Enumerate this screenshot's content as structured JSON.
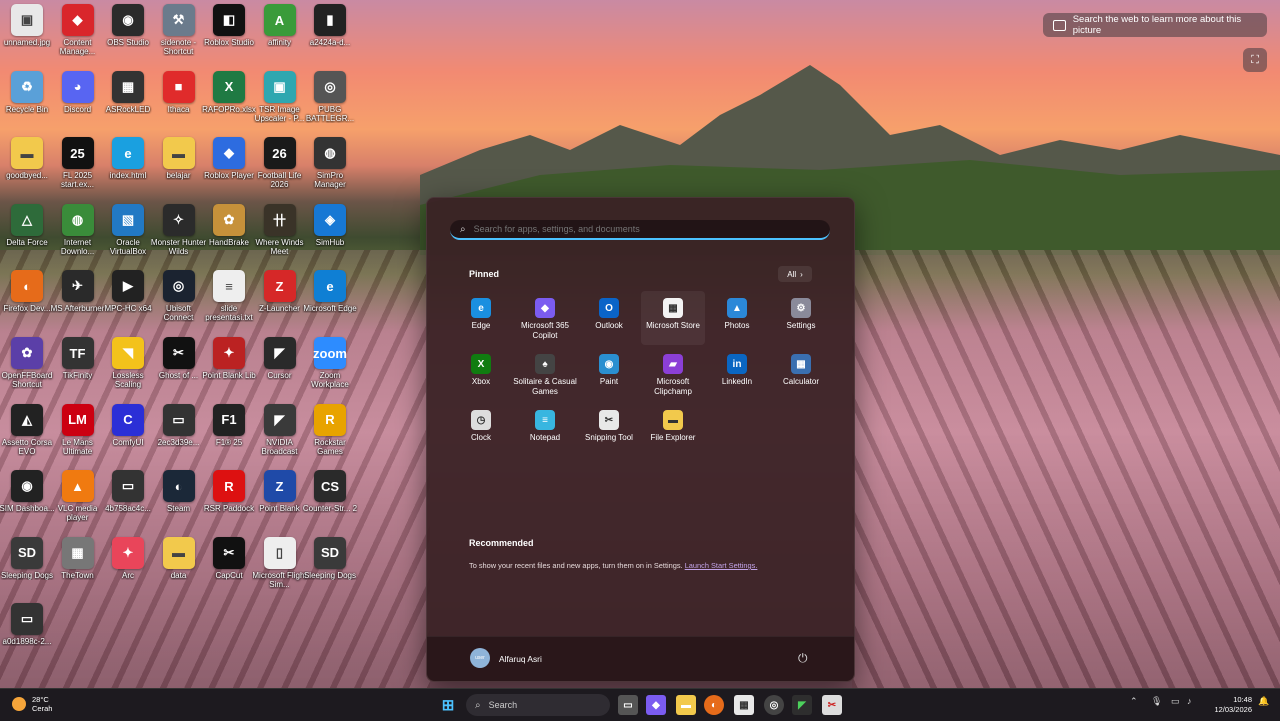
{
  "bing": {
    "text": "Search the web to learn more about this picture"
  },
  "desktop_icons": [
    {
      "label": "unnamed.jpg",
      "color": "#e8e8e8",
      "glyph": "▣"
    },
    {
      "label": "Content Manage...",
      "color": "#d9262b",
      "glyph": "◆"
    },
    {
      "label": "OBS Studio",
      "color": "#2b2b2b",
      "glyph": "◉"
    },
    {
      "label": "sidenote - Shortcut",
      "color": "#6b7b8c",
      "glyph": "⚒"
    },
    {
      "label": "Roblox Studio",
      "color": "#111",
      "glyph": "◧"
    },
    {
      "label": "affinity",
      "color": "#3a9b3a",
      "glyph": "A"
    },
    {
      "label": "a2424a-d...",
      "color": "#222",
      "glyph": "▮"
    },
    {
      "label": "Recycle Bin",
      "color": "#5aa0d8",
      "glyph": "♻"
    },
    {
      "label": "Discord",
      "color": "#5865f2",
      "glyph": "◕"
    },
    {
      "label": "ASRockLED",
      "color": "#333",
      "glyph": "▦"
    },
    {
      "label": "Ithaca",
      "color": "#e02b2b",
      "glyph": "■"
    },
    {
      "label": "RAFOPRo.xlsx",
      "color": "#1f7a43",
      "glyph": "X"
    },
    {
      "label": "TSR Image Upscaler - P...",
      "color": "#2ea7b0",
      "glyph": "▣"
    },
    {
      "label": "PUBG BATTLEGR...",
      "color": "#555",
      "glyph": "◎"
    },
    {
      "label": "goodbyed...",
      "color": "#f2c94c",
      "glyph": "▬"
    },
    {
      "label": "FL 2025 start.ex...",
      "color": "#111",
      "glyph": "25"
    },
    {
      "label": "index.html",
      "color": "#1aa0e0",
      "glyph": "e"
    },
    {
      "label": "belajar",
      "color": "#f2c94c",
      "glyph": "▬"
    },
    {
      "label": "Roblox Player",
      "color": "#2d6ce0",
      "glyph": "◆"
    },
    {
      "label": "Football Life 2026",
      "color": "#1a1a1a",
      "glyph": "26"
    },
    {
      "label": "SimPro Manager",
      "color": "#333",
      "glyph": "◍"
    },
    {
      "label": "Delta Force",
      "color": "#2e6b3a",
      "glyph": "△"
    },
    {
      "label": "Internet Downlo...",
      "color": "#3a8c3a",
      "glyph": "◍"
    },
    {
      "label": "Oracle VirtualBox",
      "color": "#2279c4",
      "glyph": "▧"
    },
    {
      "label": "Monster Hunter Wilds",
      "color": "#2b2b2b",
      "glyph": "✧"
    },
    {
      "label": "HandBrake",
      "color": "#c6913a",
      "glyph": "✿"
    },
    {
      "label": "Where Winds Meet",
      "color": "#3a3328",
      "glyph": "卄"
    },
    {
      "label": "SimHub",
      "color": "#1778d4",
      "glyph": "◈"
    },
    {
      "label": "Firefox Dev...",
      "color": "#e66b1a",
      "glyph": "◐"
    },
    {
      "label": "MS Afterburner",
      "color": "#2a2a2a",
      "glyph": "✈"
    },
    {
      "label": "MPC-HC x64",
      "color": "#222",
      "glyph": "▶"
    },
    {
      "label": "Ubisoft Connect",
      "color": "#1b2330",
      "glyph": "◎"
    },
    {
      "label": "slide presentasi.txt",
      "color": "#eee",
      "glyph": "≡"
    },
    {
      "label": "Z-Launcher",
      "color": "#d62828",
      "glyph": "Z"
    },
    {
      "label": "Microsoft Edge",
      "color": "#0f7fd4",
      "glyph": "e"
    },
    {
      "label": "OpenFFBoard Shortcut",
      "color": "#5b3fa8",
      "glyph": "✿"
    },
    {
      "label": "TikFinity",
      "color": "#333",
      "glyph": "TF"
    },
    {
      "label": "Lossless Scaling",
      "color": "#f3c21b",
      "glyph": "◥"
    },
    {
      "label": "Ghost of ...",
      "color": "#111",
      "glyph": "✂"
    },
    {
      "label": "Point Blank Lib",
      "color": "#b22",
      "glyph": "✦"
    },
    {
      "label": "Cursor",
      "color": "#2a2a2a",
      "glyph": "◤"
    },
    {
      "label": "Zoom Workplace",
      "color": "#2d8cff",
      "glyph": "zoom"
    },
    {
      "label": "Assetto Corsa EVO",
      "color": "#222",
      "glyph": "◭"
    },
    {
      "label": "Le Mans Ultimate",
      "color": "#c01",
      "glyph": "LM"
    },
    {
      "label": "ComfyUI",
      "color": "#2b2fd6",
      "glyph": "C"
    },
    {
      "label": "2ec3d39e...",
      "color": "#333",
      "glyph": "▭"
    },
    {
      "label": "F1® 25",
      "color": "#222",
      "glyph": "F1"
    },
    {
      "label": "NVIDIA Broadcast",
      "color": "#3a3a3a",
      "glyph": "◤"
    },
    {
      "label": "Rockstar Games",
      "color": "#e8a300",
      "glyph": "R"
    },
    {
      "label": "SIM Dashboa...",
      "color": "#222",
      "glyph": "◉"
    },
    {
      "label": "VLC media player",
      "color": "#f07a10",
      "glyph": "▲"
    },
    {
      "label": "4b758ac4c...",
      "color": "#333",
      "glyph": "▭"
    },
    {
      "label": "Steam",
      "color": "#1b2838",
      "glyph": "◐"
    },
    {
      "label": "RSR Paddock",
      "color": "#d11",
      "glyph": "R"
    },
    {
      "label": "Point Blank",
      "color": "#1f4aa8",
      "glyph": "Z"
    },
    {
      "label": "Counter-Str... 2",
      "color": "#2a2a2a",
      "glyph": "CS"
    },
    {
      "label": "Sleeping Dogs",
      "color": "#3a3a3a",
      "glyph": "SD"
    },
    {
      "label": "TheTown",
      "color": "#777",
      "glyph": "▦"
    },
    {
      "label": "Arc",
      "color": "#e9455a",
      "glyph": "✦"
    },
    {
      "label": "data",
      "color": "#f2c94c",
      "glyph": "▬"
    },
    {
      "label": "CapCut",
      "color": "#111",
      "glyph": "✂"
    },
    {
      "label": "Microsoft Flight Sim...",
      "color": "#eee",
      "glyph": "▯"
    },
    {
      "label": "Sleeping Dogs",
      "color": "#3a3a3a",
      "glyph": "SD"
    },
    {
      "label": "a0d1898c-2...",
      "color": "#333",
      "glyph": "▭"
    }
  ],
  "start": {
    "search_placeholder": "Search for apps, settings, and documents",
    "pinned_title": "Pinned",
    "all_label": "All",
    "apps": [
      {
        "label": "Edge",
        "color": "#1a8fe0",
        "glyph": "e"
      },
      {
        "label": "Microsoft 365 Copilot",
        "color": "#7b5cf0",
        "glyph": "◆"
      },
      {
        "label": "Outlook",
        "color": "#0a64c8",
        "glyph": "O"
      },
      {
        "label": "Microsoft Store",
        "color": "#f3f3f3",
        "glyph": "▦"
      },
      {
        "label": "Photos",
        "color": "#2b88d8",
        "glyph": "▲"
      },
      {
        "label": "Settings",
        "color": "#8a8a9a",
        "glyph": "⚙"
      },
      {
        "label": "Xbox",
        "color": "#107c10",
        "glyph": "X"
      },
      {
        "label": "Solitaire & Casual Games",
        "color": "#444",
        "glyph": "♠"
      },
      {
        "label": "Paint",
        "color": "#2a8fd0",
        "glyph": "◉"
      },
      {
        "label": "Microsoft Clipchamp",
        "color": "#8b3fd6",
        "glyph": "▰"
      },
      {
        "label": "LinkedIn",
        "color": "#0a66c2",
        "glyph": "in"
      },
      {
        "label": "Calculator",
        "color": "#3a6fb0",
        "glyph": "▦"
      },
      {
        "label": "Clock",
        "color": "#ddd",
        "glyph": "◷"
      },
      {
        "label": "Notepad",
        "color": "#38b6e0",
        "glyph": "≡"
      },
      {
        "label": "Snipping Tool",
        "color": "#e8e8e8",
        "glyph": "✂"
      },
      {
        "label": "File Explorer",
        "color": "#f2c94c",
        "glyph": "▬"
      }
    ],
    "recommended_title": "Recommended",
    "recommended_text": "To show your recent files and new apps, turn them on in Settings.",
    "recommended_link": "Launch Start Settings.",
    "user_name": "Alfaruq Asri",
    "avatar_text": "user"
  },
  "taskbar": {
    "temp": "28°C",
    "weather": "Cerah",
    "search_label": "Search",
    "time": "10:48",
    "date": "12/03/2026"
  }
}
